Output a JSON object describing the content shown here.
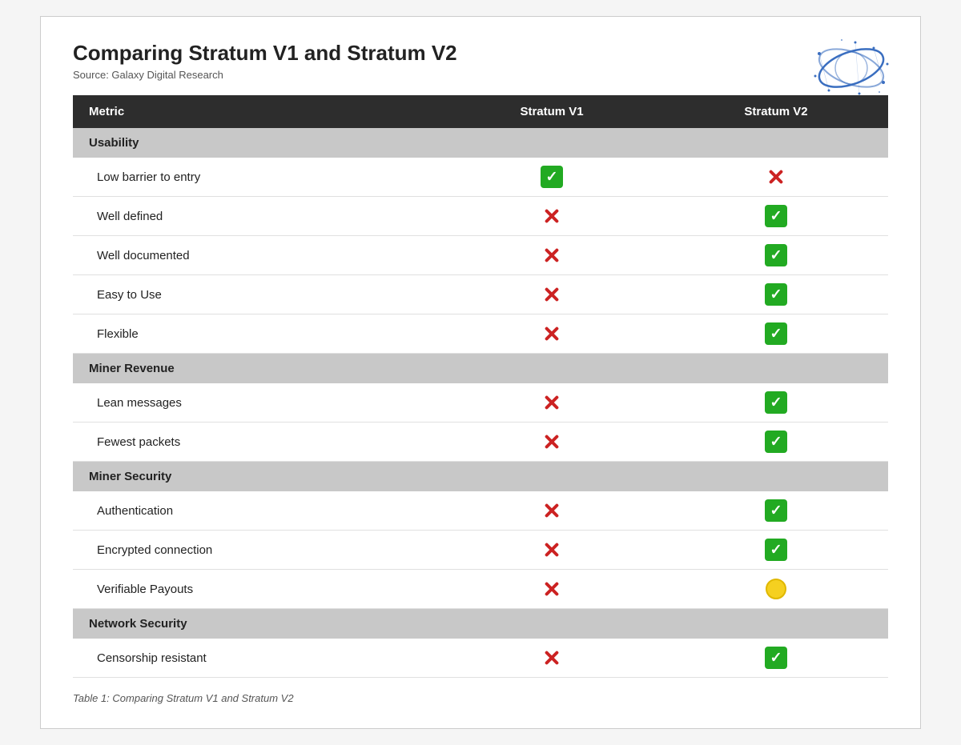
{
  "header": {
    "title": "Comparing Stratum V1 and Stratum V2",
    "source": "Source: Galaxy Digital Research"
  },
  "columns": {
    "metric": "Metric",
    "v1": "Stratum V1",
    "v2": "Stratum V2"
  },
  "sections": [
    {
      "name": "Usability",
      "rows": [
        {
          "label": "Low barrier to entry",
          "v1": "check",
          "v2": "cross"
        },
        {
          "label": "Well defined",
          "v1": "cross",
          "v2": "check"
        },
        {
          "label": "Well documented",
          "v1": "cross",
          "v2": "check"
        },
        {
          "label": "Easy to Use",
          "v1": "cross",
          "v2": "check"
        },
        {
          "label": "Flexible",
          "v1": "cross",
          "v2": "check"
        }
      ]
    },
    {
      "name": "Miner Revenue",
      "rows": [
        {
          "label": "Lean messages",
          "v1": "cross",
          "v2": "check"
        },
        {
          "label": "Fewest packets",
          "v1": "cross",
          "v2": "check"
        }
      ]
    },
    {
      "name": "Miner Security",
      "rows": [
        {
          "label": "Authentication",
          "v1": "cross",
          "v2": "check"
        },
        {
          "label": "Encrypted connection",
          "v1": "cross",
          "v2": "check"
        },
        {
          "label": "Verifiable Payouts",
          "v1": "cross",
          "v2": "circle"
        }
      ]
    },
    {
      "name": "Network Security",
      "rows": [
        {
          "label": "Censorship resistant",
          "v1": "cross",
          "v2": "check"
        }
      ]
    }
  ],
  "caption": "Table 1: Comparing Stratum V1 and Stratum V2"
}
